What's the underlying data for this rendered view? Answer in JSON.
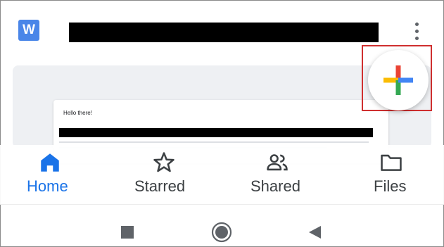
{
  "app": {
    "logo_letter": "W"
  },
  "document": {
    "greeting": "Hello there!"
  },
  "bottom_nav": {
    "items": [
      {
        "id": "home",
        "label": "Home",
        "icon": "home-icon",
        "active": true
      },
      {
        "id": "starred",
        "label": "Starred",
        "icon": "star-icon",
        "active": false
      },
      {
        "id": "shared",
        "label": "Shared",
        "icon": "people-icon",
        "active": false
      },
      {
        "id": "files",
        "label": "Files",
        "icon": "folder-icon",
        "active": false
      }
    ]
  },
  "colors": {
    "active": "#1a73e8",
    "inactive": "#3c4043",
    "plus_red": "#ea4335",
    "plus_yellow": "#fbbc04",
    "plus_green": "#34a853",
    "plus_blue": "#4285f4",
    "highlight_box": "#cf2f2f"
  }
}
